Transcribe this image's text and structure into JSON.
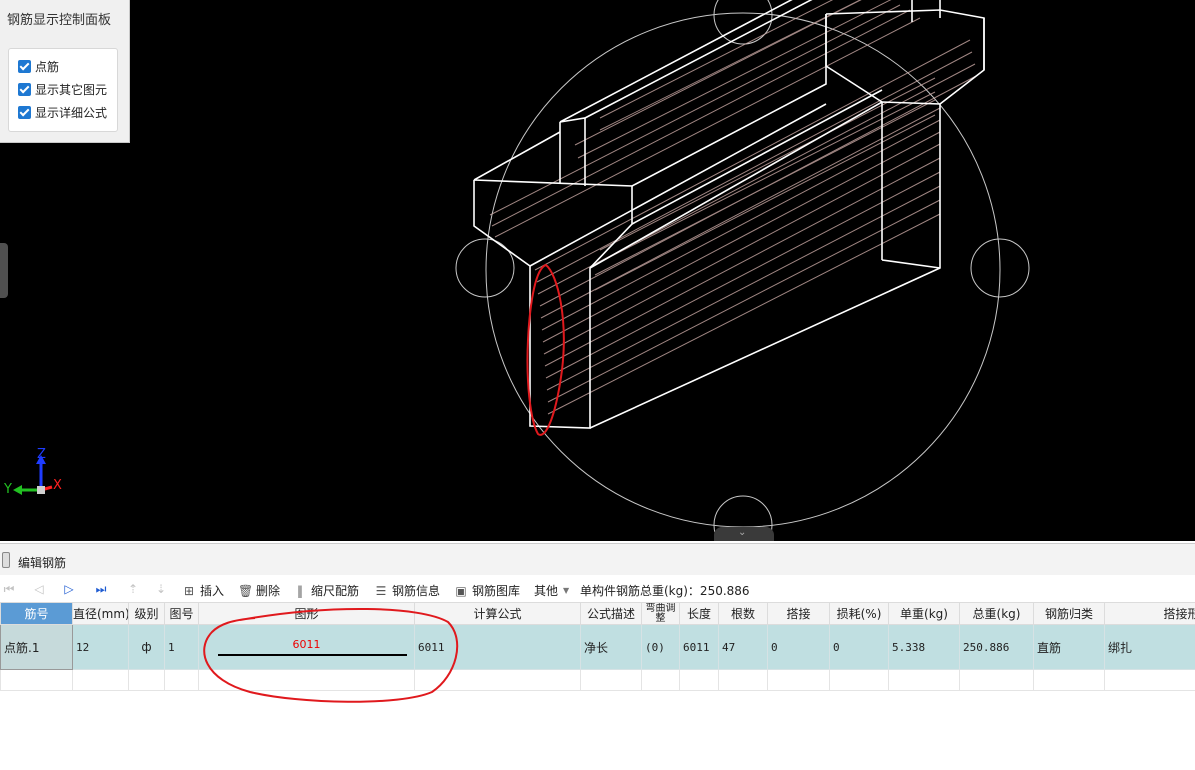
{
  "control_panel": {
    "title": "钢筋显示控制面板",
    "options": [
      {
        "label": "点筋",
        "checked": true
      },
      {
        "label": "显示其它图元",
        "checked": true
      },
      {
        "label": "显示详细公式",
        "checked": true
      }
    ]
  },
  "axis": {
    "x": "X",
    "y": "Y",
    "z": "Z"
  },
  "panel": {
    "title": "编辑钢筋"
  },
  "toolbar": {
    "insert": "插入",
    "delete": "删除",
    "scale_rebar": "缩尺配筋",
    "rebar_info": "钢筋信息",
    "rebar_library": "钢筋图库",
    "other": "其他",
    "total_weight_label": "单构件钢筋总重(kg)：250.886"
  },
  "table": {
    "headers": [
      "筋号",
      "直径(mm)",
      "级别",
      "图号",
      "图形",
      "计算公式",
      "公式描述",
      "弯曲调整",
      "长度",
      "根数",
      "搭接",
      "损耗(%)",
      "单重(kg)",
      "总重(kg)",
      "钢筋归类",
      "搭接形式"
    ],
    "row": {
      "name": "点筋.1",
      "diameter": "12",
      "grade": "ф",
      "shape_no": "1",
      "shape_value": "6011",
      "shape_right": "6011",
      "formula": "",
      "formula_desc": "净长",
      "bend_adjust": "(0)",
      "length": "6011",
      "count": "47",
      "lap": "0",
      "loss": "0",
      "unit_weight": "5.338",
      "total_weight": "250.886",
      "category": "直筋",
      "lap_type": "绑扎"
    }
  },
  "colors": {
    "accent": "#1e78d2",
    "annotation": "#e0191d",
    "row_highlight": "#c0dfe1",
    "viewport_bg": "#000000"
  }
}
